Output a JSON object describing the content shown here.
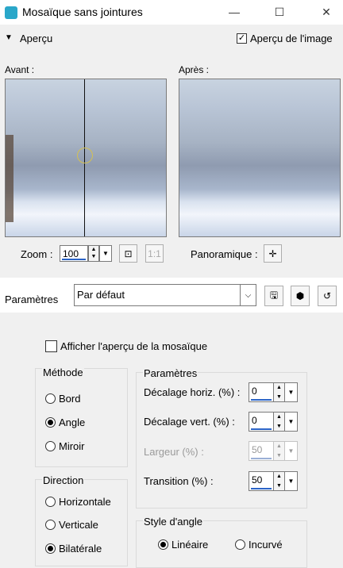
{
  "window": {
    "title": "Mosaïque sans jointures",
    "minimize": "—",
    "maximize": "☐",
    "close": "✕"
  },
  "preview_bar": {
    "label": "Aperçu",
    "image_preview_label": "Aperçu de l'image",
    "image_preview_checked": true
  },
  "preview": {
    "before_label": "Avant :",
    "after_label": "Après :",
    "zoom_label": "Zoom :",
    "zoom_value": "100",
    "pan_label": "Panoramique :"
  },
  "params": {
    "label": "Paramètres",
    "preset": "Par défaut"
  },
  "mosaic_preview": {
    "label": "Afficher l'aperçu de la mosaïque",
    "checked": false
  },
  "method": {
    "title": "Méthode",
    "options": [
      {
        "label": "Bord",
        "selected": false
      },
      {
        "label": "Angle",
        "selected": true
      },
      {
        "label": "Miroir",
        "selected": false
      }
    ]
  },
  "direction": {
    "title": "Direction",
    "options": [
      {
        "label": "Horizontale",
        "selected": false
      },
      {
        "label": "Verticale",
        "selected": false
      },
      {
        "label": "Bilatérale",
        "selected": true
      }
    ]
  },
  "settings": {
    "title": "Paramètres",
    "fields": [
      {
        "label": "Décalage horiz. (%) :",
        "value": "0",
        "enabled": true
      },
      {
        "label": "Décalage vert. (%) :",
        "value": "0",
        "enabled": true
      },
      {
        "label": "Largeur (%) :",
        "value": "50",
        "enabled": false
      },
      {
        "label": "Transition (%) :",
        "value": "50",
        "enabled": true
      }
    ]
  },
  "corner_style": {
    "title": "Style d'angle",
    "options": [
      {
        "label": "Linéaire",
        "selected": true
      },
      {
        "label": "Incurvé",
        "selected": false
      }
    ]
  }
}
